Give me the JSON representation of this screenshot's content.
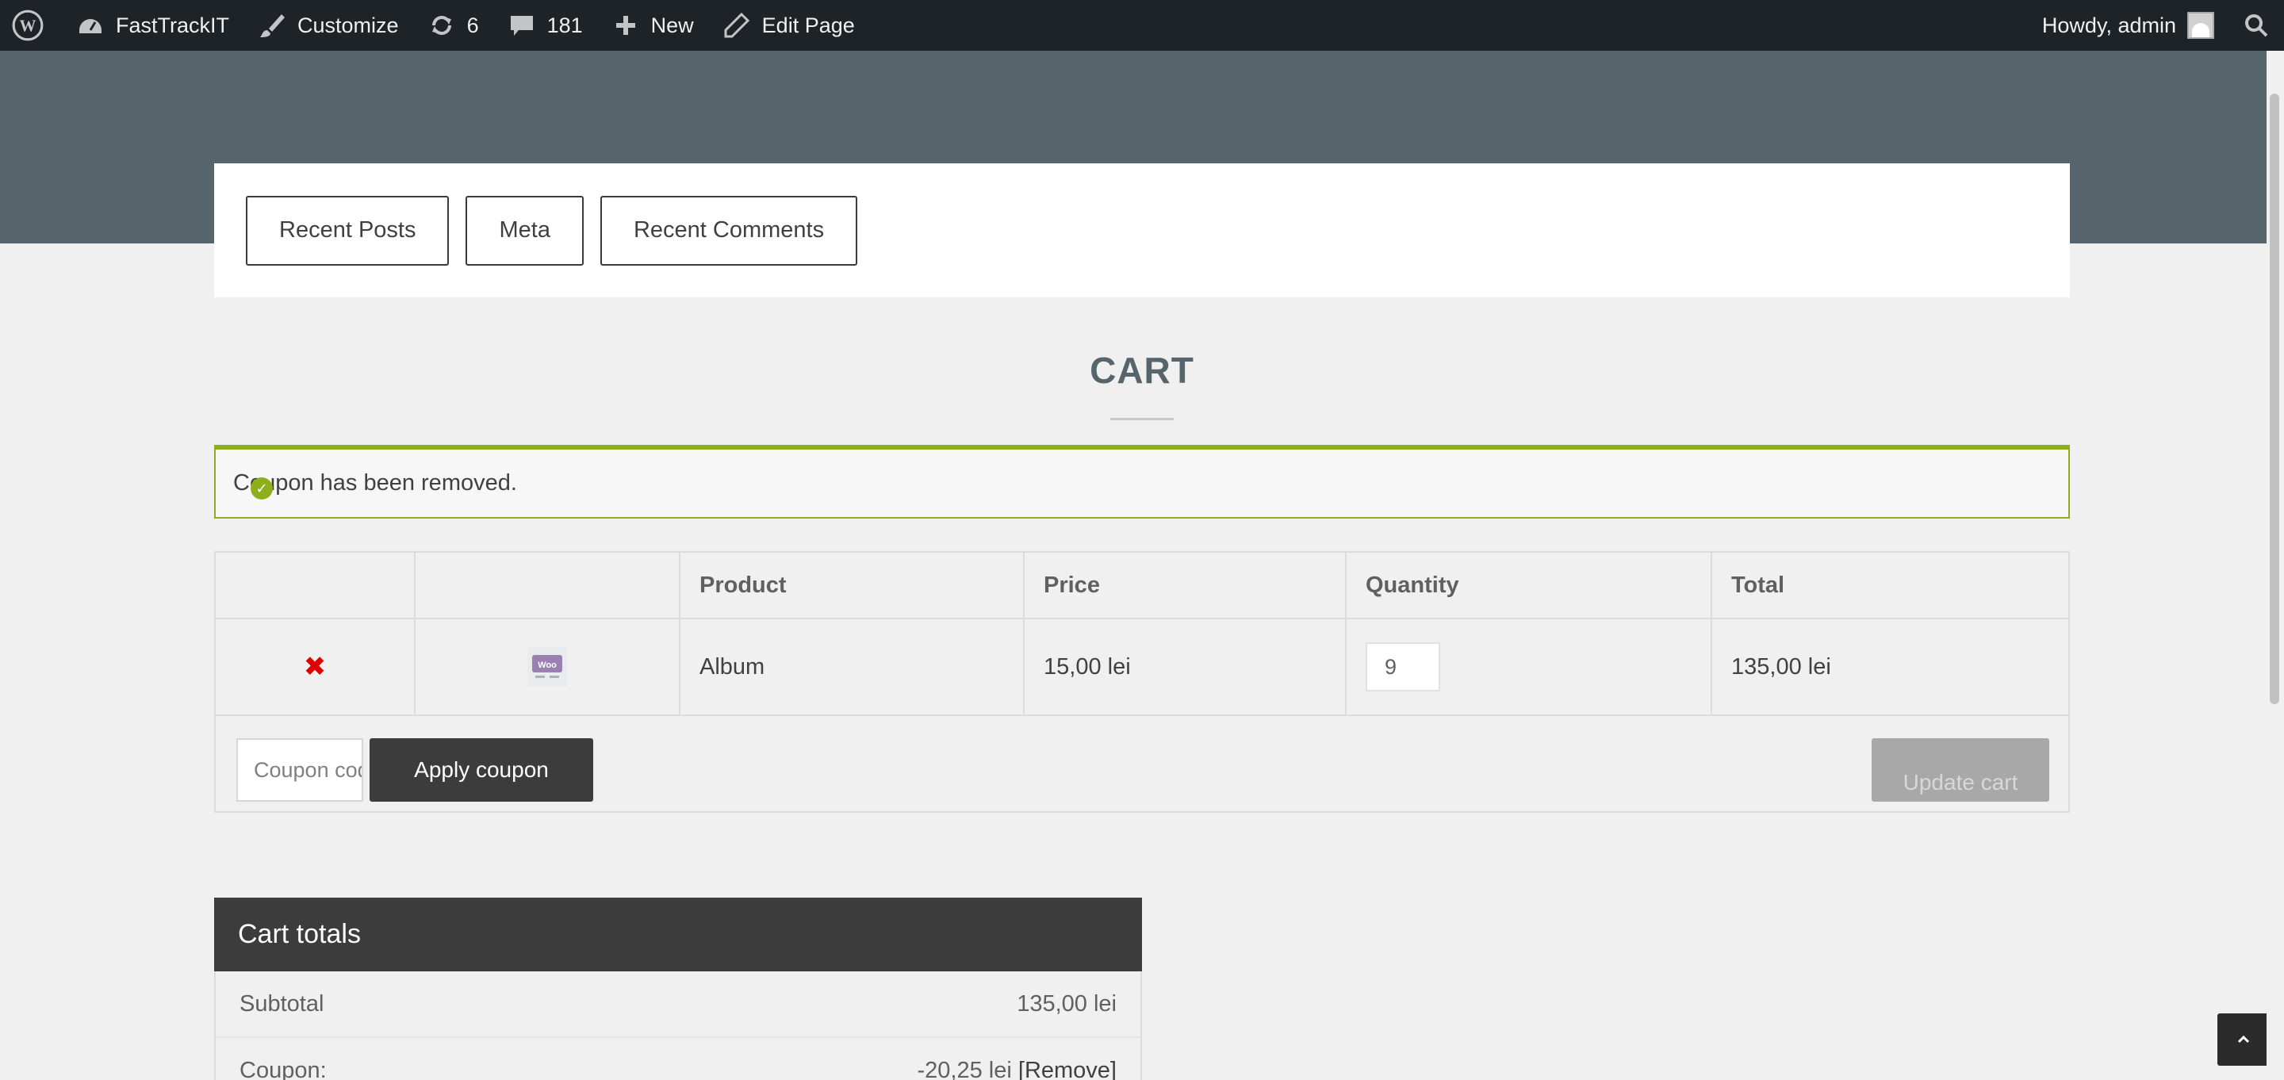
{
  "admin_bar": {
    "site_name": "FastTrackIT",
    "customize": "Customize",
    "updates_count": "6",
    "comments_count": "181",
    "new_label": "New",
    "edit_page": "Edit Page",
    "greeting": "Howdy, admin"
  },
  "widget_buttons": [
    "Recent Posts",
    "Meta",
    "Recent Comments"
  ],
  "page_title": "CART",
  "notice": "Coupon has been removed.",
  "cart_table": {
    "headers": [
      "",
      "",
      "Product",
      "Price",
      "Quantity",
      "Total"
    ],
    "items": [
      {
        "product": "Album",
        "price": "15,00 lei",
        "quantity": "9",
        "total": "135,00 lei"
      }
    ]
  },
  "actions": {
    "coupon_placeholder": "Coupon code",
    "apply_coupon": "Apply coupon",
    "update_cart": "Update cart"
  },
  "cart_totals": {
    "title": "Cart totals",
    "subtotal_label": "Subtotal",
    "subtotal_value": "135,00 lei",
    "coupon_label": "Coupon:",
    "coupon_value": "-20,25 lei",
    "coupon_remove": "[Remove]"
  },
  "colors": {
    "admin_bar": "#1d2327",
    "hero": "#56646b",
    "notice_accent": "#8fae1b",
    "remove_x": "#e00000",
    "dark_button": "#3c3c3c"
  }
}
